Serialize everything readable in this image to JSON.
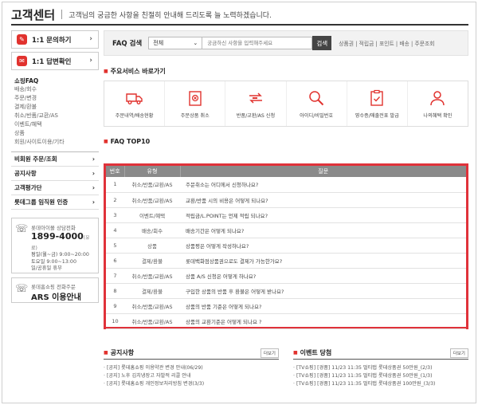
{
  "header": {
    "title": "고객센터",
    "subtitle": "고객님의 궁금한 사항을 친절히 안내해 드리도록 늘 노력하겠습니다."
  },
  "sidebar": {
    "inquiry_button": "1:1 문의하기",
    "answer_button": "1:1 답변확인",
    "category_title": "쇼핑FAQ",
    "categories": [
      "배송/회수",
      "주문/변경",
      "결제/환불",
      "취소/반품/교환/AS",
      "이벤트/혜택",
      "상품",
      "회원/사이트이용/기타"
    ],
    "nav": [
      "비회원 주문/조회",
      "공지사항",
      "고객평가단",
      "롯데그룹 임직원 인증"
    ],
    "phone": {
      "label": "롯데아이몰 상담전화",
      "number": "1899-4000",
      "number_note": "(유료)",
      "hours": [
        "평일(월~금) 9:00~20:00",
        "토요일 9:00~13:00",
        "일/공휴일 휴무"
      ]
    },
    "ars": {
      "label": "롯데홈쇼핑 전화주문",
      "title": "ARS 이용안내"
    }
  },
  "search": {
    "label": "FAQ 검색",
    "select_value": "전체",
    "placeholder": "궁금하신 사항을 입력해주세요",
    "button": "검색",
    "quick_links": "상품권 | 적립금 | 포인트 | 배송 | 주문조회"
  },
  "services": {
    "title": "주요서비스 바로가기",
    "items": [
      {
        "label": "주문내역/배송현황",
        "icon": "truck-icon"
      },
      {
        "label": "주문상품 취소",
        "icon": "cancel-box-icon"
      },
      {
        "label": "반품/교환/AS 신청",
        "icon": "exchange-icon"
      },
      {
        "label": "아이디/비밀번호",
        "icon": "magnifier-icon"
      },
      {
        "label": "영수증/매출전표 발급",
        "icon": "receipt-icon"
      },
      {
        "label": "나의혜택 확인",
        "icon": "person-icon"
      }
    ]
  },
  "faq": {
    "title": "FAQ TOP10",
    "headers": {
      "num": "번호",
      "type": "유형",
      "question": "질문"
    },
    "rows": [
      {
        "num": "1",
        "type": "취소/반품/교환/AS",
        "question": "주문취소는 어디에서 신청하나요?"
      },
      {
        "num": "2",
        "type": "취소/반품/교환/AS",
        "question": "교환/반품 시의 비용은 어떻게 되나요?"
      },
      {
        "num": "3",
        "type": "이벤트/혜택",
        "question": "적립금/L.POINT는 언제 적립 되나요?"
      },
      {
        "num": "4",
        "type": "배송/회수",
        "question": "배송기간은 어떻게 되나요?"
      },
      {
        "num": "5",
        "type": "상품",
        "question": "상품평은 어떻게 작성하나요?"
      },
      {
        "num": "6",
        "type": "결제/환불",
        "question": "롯데백화점상품권으로도 결제가 가능한가요?"
      },
      {
        "num": "7",
        "type": "취소/반품/교환/AS",
        "question": "상품 A/S 신청은 어떻게 하나요?"
      },
      {
        "num": "8",
        "type": "결제/환불",
        "question": "구입한 상품의 반품 후 환불은 어떻게 받나요?"
      },
      {
        "num": "9",
        "type": "취소/반품/교환/AS",
        "question": "상품의 반품 기준은 어떻게 되나요?"
      },
      {
        "num": "10",
        "type": "취소/반품/교환/AS",
        "question": "상품의 교환기준은 어떻게 되나요 ?"
      }
    ]
  },
  "notice": {
    "title": "공지사항",
    "more": "더보기",
    "items": [
      "[공지] 롯데홈쇼핑 이용약관 변경 안내(06/29)",
      "[공지] 노후 김치냉장고 자발적 리콜 안내",
      "[공지] 롯데홈쇼핑 개인정보처리방침 변경(3/3)"
    ]
  },
  "event": {
    "title": "이벤트 당첨",
    "more": "더보기",
    "items": [
      "[TV쇼핑] [경품] 11/23 11:35 멀티탭 롯데상품권 50만원_(2/3)",
      "[TV쇼핑] [경품] 11/23 11:35 멀티탭 롯데상품권 50만원_(1/3)",
      "[TV쇼핑] [경품] 11/23 11:35 멀티탭 롯데상품권 100만원_(3/3)"
    ]
  },
  "colors": {
    "accent": "#e1322e",
    "highlight_border": "#e0323a",
    "table_header": "#8a8a8a"
  }
}
